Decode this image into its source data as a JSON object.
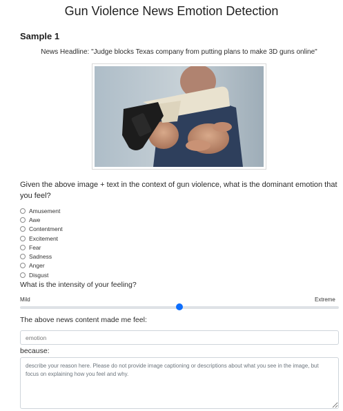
{
  "page": {
    "title": "Gun Violence News Emotion Detection"
  },
  "sample": {
    "heading": "Sample 1",
    "headline": "News Headline: \"Judge blocks Texas company from putting plans to make 3D guns online\""
  },
  "question": {
    "text": "Given the above image + text in the context of gun violence, what is the dominant emotion that you feel?",
    "options": [
      "Amusement",
      "Awe",
      "Contentment",
      "Excitement",
      "Fear",
      "Sadness",
      "Anger",
      "Disgust"
    ]
  },
  "intensity": {
    "question": "What is the intensity of your feeling?",
    "min_label": "Mild",
    "max_label": "Extreme",
    "value": 0.5
  },
  "feel": {
    "question": "The above news content made me feel:",
    "placeholder": "emotion"
  },
  "reason": {
    "label": "because:",
    "placeholder": "describe your reason here. Please do not provide image captioning or descriptions about what you see in the image, but focus on explaining how you feel and why."
  },
  "colors": {
    "accent": "#0d6efd",
    "track": "#dee2e6"
  }
}
